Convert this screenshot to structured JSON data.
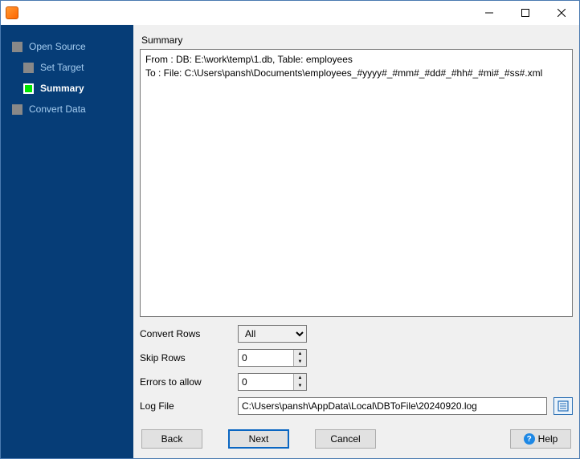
{
  "titlebar": {
    "title": ""
  },
  "sidebar": {
    "steps": [
      {
        "label": "Open Source",
        "active": false,
        "sub": false
      },
      {
        "label": "Set Target",
        "active": false,
        "sub": true
      },
      {
        "label": "Summary",
        "active": true,
        "sub": true
      },
      {
        "label": "Convert Data",
        "active": false,
        "sub": false
      }
    ]
  },
  "main": {
    "summary_label": "Summary",
    "summary_text": "From : DB: E:\\work\\temp\\1.db, Table: employees\nTo : File: C:\\Users\\pansh\\Documents\\employees_#yyyy#_#mm#_#dd#_#hh#_#mi#_#ss#.xml",
    "form": {
      "convert_rows_label": "Convert Rows",
      "convert_rows_value": "All",
      "skip_rows_label": "Skip Rows",
      "skip_rows_value": "0",
      "errors_label": "Errors to allow",
      "errors_value": "0",
      "logfile_label": "Log File",
      "logfile_value": "C:\\Users\\pansh\\AppData\\Local\\DBToFile\\20240920.log"
    }
  },
  "buttons": {
    "back": "Back",
    "next": "Next",
    "cancel": "Cancel",
    "help": "Help"
  }
}
